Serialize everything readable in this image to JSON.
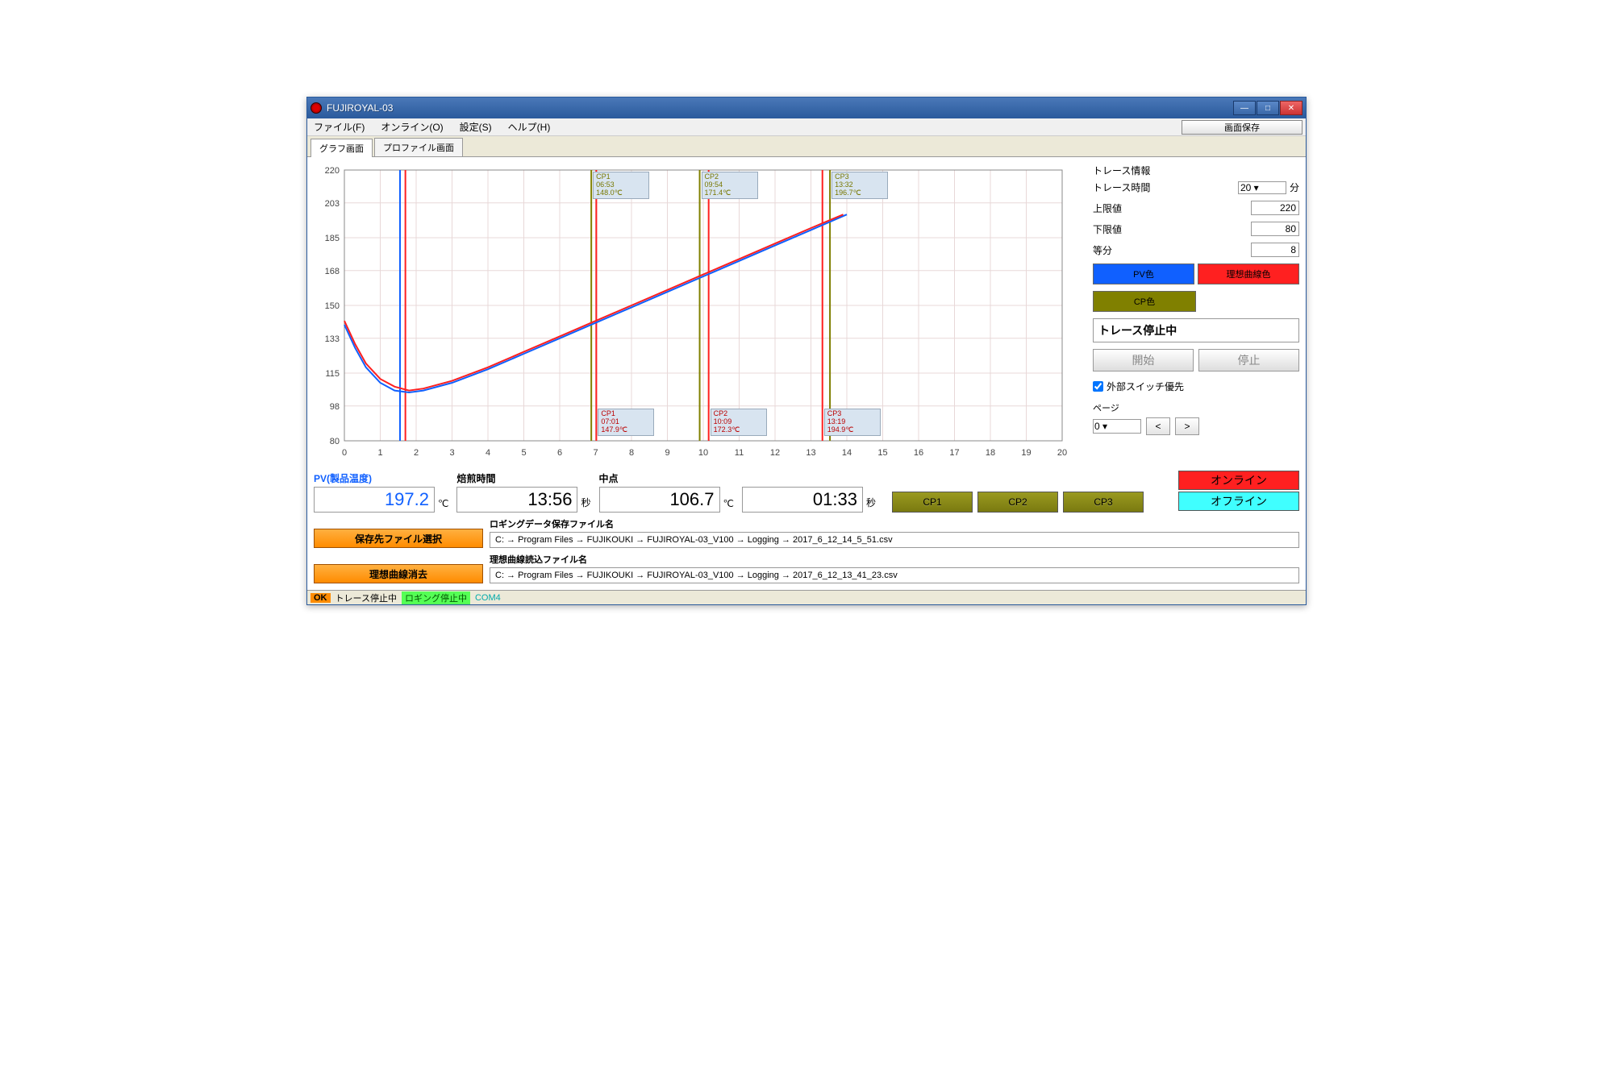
{
  "window": {
    "title": "FUJIROYAL-03"
  },
  "menubar": {
    "file": "ファイル(F)",
    "online": "オンライン(O)",
    "settings": "設定(S)",
    "help": "ヘルプ(H)",
    "save_screen": "画面保存"
  },
  "tabs": {
    "graph": "グラフ画面",
    "profile": "プロファイル画面"
  },
  "side": {
    "trace_info_title": "トレース情報",
    "trace_time_label": "トレース時間",
    "trace_time_value": "20",
    "trace_time_unit": "分",
    "upper_label": "上限値",
    "upper_value": "220",
    "lower_label": "下限値",
    "lower_value": "80",
    "div_label": "等分",
    "div_value": "8",
    "pv_color": "PV色",
    "ideal_color": "理想曲線色",
    "cp_color": "CP色",
    "trace_status": "トレース停止中",
    "start": "開始",
    "stop": "停止",
    "ext_switch": "外部スイッチ優先",
    "page_label": "ページ",
    "page_value": "0",
    "prev": "<",
    "next": ">"
  },
  "readouts": {
    "pv_label": "PV(製品温度)",
    "pv_value": "197.2",
    "pv_unit": "℃",
    "roast_label": "焙煎時間",
    "roast_value": "13:56",
    "roast_unit": "秒",
    "mid_label": "中点",
    "mid_value": "106.7",
    "mid_unit": "℃",
    "mid_time_value": "01:33",
    "mid_time_unit": "秒"
  },
  "cp_buttons": {
    "cp1": "CP1",
    "cp2": "CP2",
    "cp3": "CP3"
  },
  "conn": {
    "online": "オンライン",
    "offline": "オフライン"
  },
  "files": {
    "save_btn": "保存先ファイル選択",
    "log_label": "ロギングデータ保存ファイル名",
    "log_path": "C: → Program Files → FUJIKOUKI → FUJIROYAL-03_V100 → Logging → 2017_6_12_14_5_51.csv",
    "clear_btn": "理想曲線消去",
    "ideal_label": "理想曲線読込ファイル名",
    "ideal_path": "C: → Program Files → FUJIKOUKI → FUJIROYAL-03_V100 → Logging → 2017_6_12_13_41_23.csv"
  },
  "statusbar": {
    "ok": "OK",
    "trace": "トレース停止中",
    "logging": "ロギング停止中",
    "com": "COM4"
  },
  "cp_flags_top": {
    "cp1": {
      "name": "CP1",
      "time": "06:53",
      "temp": "148.0℃"
    },
    "cp2": {
      "name": "CP2",
      "time": "09:54",
      "temp": "171.4℃"
    },
    "cp3": {
      "name": "CP3",
      "time": "13:32",
      "temp": "196.7℃"
    }
  },
  "cp_flags_bottom": {
    "cp1": {
      "name": "CP1",
      "time": "07:01",
      "temp": "147.9℃"
    },
    "cp2": {
      "name": "CP2",
      "time": "10:09",
      "temp": "172.3℃"
    },
    "cp3": {
      "name": "CP3",
      "time": "13:19",
      "temp": "194.9℃"
    }
  },
  "chart_data": {
    "type": "line",
    "xlabel": "",
    "ylabel": "",
    "xlim": [
      0,
      20
    ],
    "ylim": [
      80,
      220
    ],
    "x_ticks": [
      0,
      1,
      2,
      3,
      4,
      5,
      6,
      7,
      8,
      9,
      10,
      11,
      12,
      13,
      14,
      15,
      16,
      17,
      18,
      19,
      20
    ],
    "y_ticks": [
      80,
      98,
      115,
      133,
      150,
      168,
      185,
      203,
      220
    ],
    "series": [
      {
        "name": "PV",
        "color": "#1060ff",
        "x": [
          0,
          0.3,
          0.6,
          1.0,
          1.4,
          1.8,
          2.2,
          3,
          4,
          5,
          6,
          7,
          8,
          9,
          10,
          11,
          12,
          13,
          14
        ],
        "values": [
          140,
          128,
          118,
          110,
          106,
          105,
          106,
          110,
          117,
          125,
          133,
          141,
          149,
          157,
          165,
          173,
          181,
          189,
          197
        ]
      },
      {
        "name": "Ideal",
        "color": "#ff2020",
        "x": [
          0,
          0.3,
          0.6,
          1.0,
          1.4,
          1.8,
          2.2,
          3,
          4,
          5,
          6,
          7,
          8,
          9,
          10,
          11,
          12,
          13,
          13.9
        ],
        "values": [
          142,
          130,
          120,
          112,
          108,
          106,
          107,
          111,
          118,
          126,
          134,
          142,
          150,
          158,
          166,
          174,
          182,
          190,
          197
        ]
      }
    ],
    "vlines": [
      {
        "x": 1.55,
        "color": "#1060ff"
      },
      {
        "x": 1.7,
        "color": "#ff2020"
      },
      {
        "x": 6.88,
        "color": "#808000"
      },
      {
        "x": 7.02,
        "color": "#ff2020"
      },
      {
        "x": 9.9,
        "color": "#808000"
      },
      {
        "x": 10.15,
        "color": "#ff2020"
      },
      {
        "x": 13.32,
        "color": "#ff2020"
      },
      {
        "x": 13.53,
        "color": "#808000"
      }
    ]
  }
}
